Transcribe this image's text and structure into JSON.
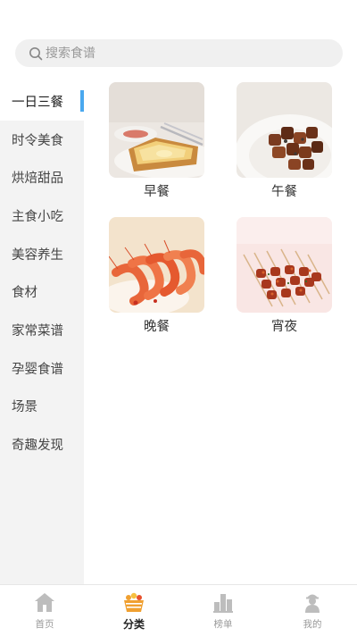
{
  "search": {
    "placeholder": "搜索食谱",
    "icon": "search-icon"
  },
  "sidebar": {
    "items": [
      {
        "label": "一日三餐",
        "active": true
      },
      {
        "label": "时令美食"
      },
      {
        "label": "烘焙甜品"
      },
      {
        "label": "主食小吃"
      },
      {
        "label": "美容养生"
      },
      {
        "label": "食材"
      },
      {
        "label": "家常菜谱"
      },
      {
        "label": "孕婴食谱"
      },
      {
        "label": "场景"
      },
      {
        "label": "奇趣发现"
      }
    ]
  },
  "categories": [
    {
      "label": "早餐",
      "image": "toast-breakfast-photo"
    },
    {
      "label": "午餐",
      "image": "beef-cubes-photo"
    },
    {
      "label": "晚餐",
      "image": "shrimp-photo"
    },
    {
      "label": "宵夜",
      "image": "skewers-photo"
    }
  ],
  "bottom_nav": {
    "items": [
      {
        "label": "首页",
        "icon": "home-icon"
      },
      {
        "label": "分类",
        "icon": "category-basket-icon",
        "active": true
      },
      {
        "label": "榜单",
        "icon": "ranking-icon"
      },
      {
        "label": "我的",
        "icon": "profile-icon"
      }
    ]
  },
  "colors": {
    "accent": "#4aa8ef",
    "sidebar_bg": "#f3f3f3",
    "category_icon": "#f0a030"
  }
}
